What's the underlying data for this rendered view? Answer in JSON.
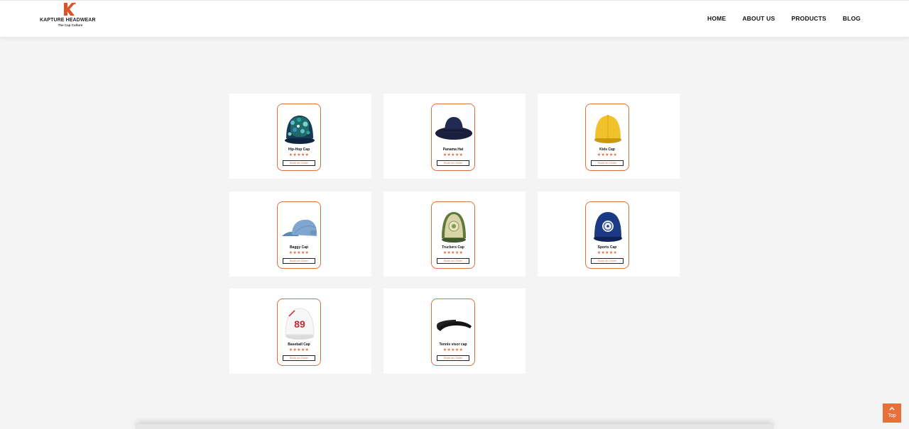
{
  "brand": {
    "name": "KAPTURE HEADWEAR",
    "tagline": "The Cap Culture",
    "accent_color": "#e8703d"
  },
  "nav": {
    "items": [
      {
        "label": "HOME"
      },
      {
        "label": "ABOUT US"
      },
      {
        "label": "PRODUCTS"
      },
      {
        "label": "BLOG"
      }
    ]
  },
  "products": [
    {
      "name": "Hip-Hop Cap",
      "stars": "★★★★★",
      "button": "Book an Order",
      "image": "floral-snapback-cap"
    },
    {
      "name": "Panama Hat",
      "stars": "★★★★★",
      "button": "Book an Order",
      "image": "navy-bucket-hat"
    },
    {
      "name": "Kids Cap",
      "stars": "★★★★★",
      "button": "Book an Order",
      "image": "yellow-cap"
    },
    {
      "name": "Baggy Cap",
      "stars": "★★★★★",
      "button": "Book an Order",
      "image": "light-blue-denim-cap"
    },
    {
      "name": "Truckers Cap",
      "stars": "★★★★★",
      "button": "Book an Order",
      "image": "green-trucker-cap"
    },
    {
      "name": "Sports Cap",
      "stars": "★★★★★",
      "button": "Book an Order",
      "image": "navy-sports-cap"
    },
    {
      "name": "Baseball Cap",
      "stars": "★★★★★",
      "button": "Book an Order",
      "image": "white-baseball-cap-89"
    },
    {
      "name": "Tennis visor cap",
      "stars": "★★★★★",
      "button": "Book an Order",
      "image": "black-visor"
    }
  ],
  "baseball_number": "89",
  "scroll_top": {
    "label": "Top",
    "icon": "chevron-up-icon"
  }
}
